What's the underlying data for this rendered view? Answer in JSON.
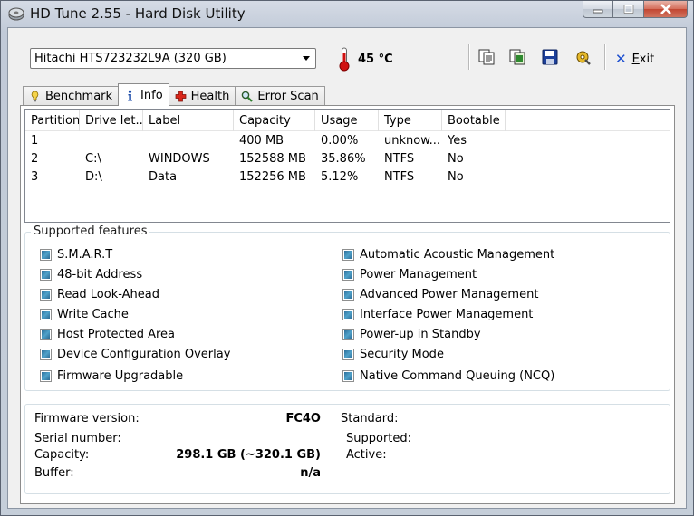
{
  "window": {
    "title": "HD Tune 2.55 - Hard Disk Utility"
  },
  "toolbar": {
    "drive": "Hitachi HTS723232L9A (320 GB)",
    "temperature": "45 °C",
    "exit_label_underlined": "E",
    "exit_label_rest": "xit",
    "icons": [
      "copy-text-icon",
      "copy-screenshot-icon",
      "save-icon",
      "options-icon"
    ]
  },
  "tabs": [
    {
      "label": "Benchmark",
      "icon": "benchmark-icon",
      "active": false
    },
    {
      "label": "Info",
      "icon": "info-icon",
      "active": true
    },
    {
      "label": "Health",
      "icon": "health-icon",
      "active": false
    },
    {
      "label": "Error Scan",
      "icon": "error-scan-icon",
      "active": false
    }
  ],
  "partitions": {
    "columns": [
      "Partition",
      "Drive let...",
      "Label",
      "Capacity",
      "Usage",
      "Type",
      "Bootable"
    ],
    "rows": [
      [
        "1",
        "",
        "",
        "400 MB",
        "0.00%",
        "unknow...",
        "Yes"
      ],
      [
        "2",
        "C:\\",
        "WINDOWS",
        "152588 MB",
        "35.86%",
        "NTFS",
        "No"
      ],
      [
        "3",
        "D:\\",
        "Data",
        "152256 MB",
        "5.12%",
        "NTFS",
        "No"
      ]
    ]
  },
  "features": {
    "title": "Supported features",
    "left": [
      "S.M.A.R.T",
      "48-bit Address",
      "Read Look-Ahead",
      "Write Cache",
      "Host Protected Area",
      "Device Configuration Overlay",
      "Firmware Upgradable"
    ],
    "right": [
      "Automatic Acoustic Management",
      "Power Management",
      "Advanced Power Management",
      "Interface Power Management",
      "Power-up in Standby",
      "Security Mode",
      "Native Command Queuing (NCQ)"
    ]
  },
  "details": {
    "firmware_label": "Firmware version:",
    "firmware_value": "FC4O",
    "serial_label": "Serial number:",
    "serial_value": "",
    "capacity_label": "Capacity:",
    "capacity_value": "298.1 GB (~320.1 GB)",
    "buffer_label": "Buffer:",
    "buffer_value": "n/a",
    "standard_label": "Standard:",
    "supported_label": "Supported:",
    "active_label": "Active:"
  },
  "colors": {
    "checkbox_fill": "#3b86b5",
    "exit_icon": "#1d4fd0",
    "thermometer": "#d01010"
  }
}
